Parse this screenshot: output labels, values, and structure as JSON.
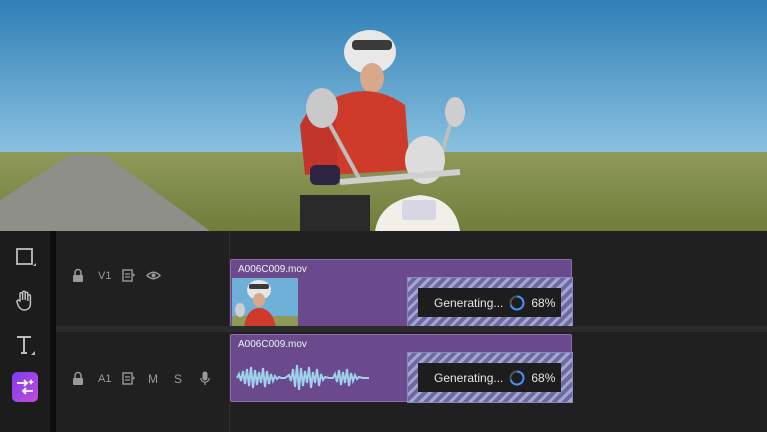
{
  "preview": {
    "image": "video-preview-scooter-rider"
  },
  "tools": [
    {
      "name": "rectangle-tool-icon"
    },
    {
      "name": "hand-tool-icon"
    },
    {
      "name": "text-tool-icon"
    },
    {
      "name": "generative-extend-tool-icon",
      "active": true
    }
  ],
  "tracks": {
    "video": {
      "label": "V1",
      "clip": {
        "name": "A006C009.mov",
        "status": "Generating...",
        "progress": "68%"
      }
    },
    "audio": {
      "label": "A1",
      "mute": "M",
      "solo": "S",
      "clip": {
        "name": "A006C009.mov",
        "status": "Generating...",
        "progress": "68%"
      }
    }
  },
  "colors": {
    "clip": "#6a4a8c",
    "accent": "#4a8cff",
    "tool_active": "#8a3ef0"
  }
}
